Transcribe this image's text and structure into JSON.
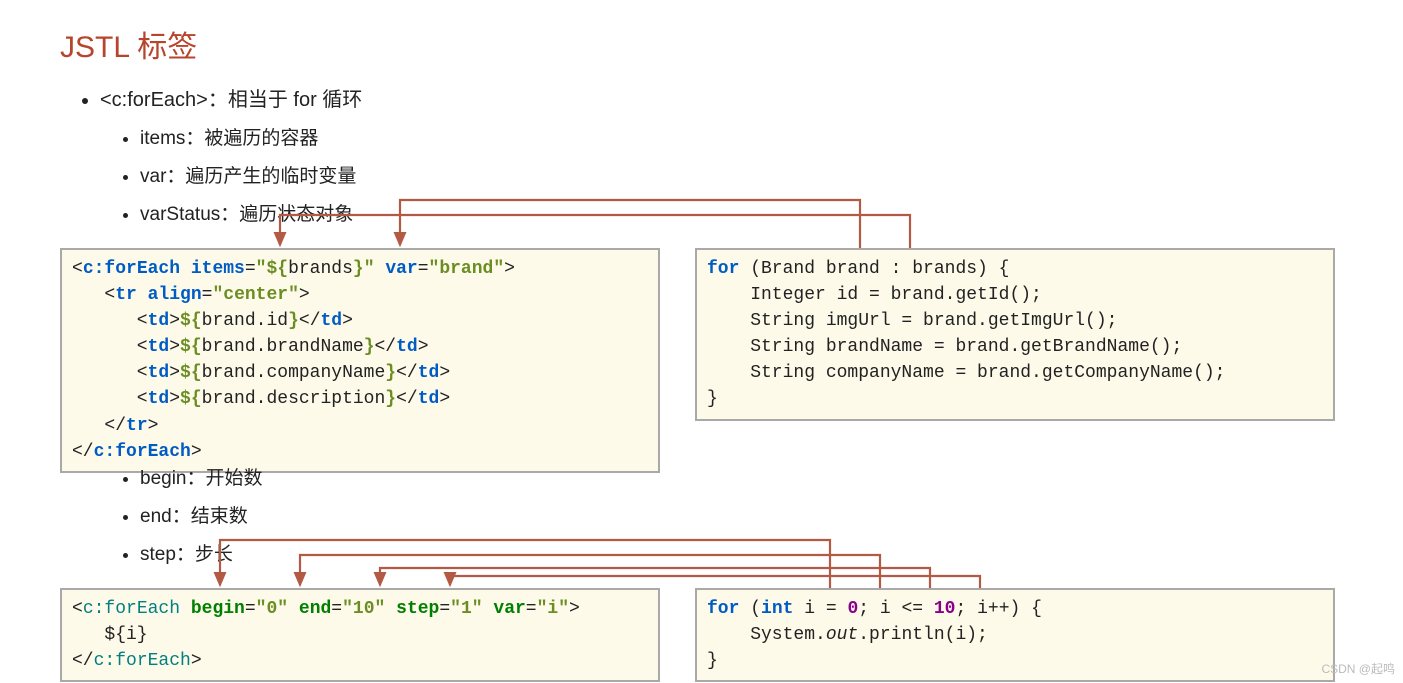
{
  "title": "JSTL 标签",
  "mainBullet": "<c:forEach>：相当于 for 循环",
  "subBullets1": {
    "items": "items：被遍历的容器",
    "var": "var：遍历产生的临时变量",
    "varStatus": "varStatus：遍历状态对象"
  },
  "subBullets2": {
    "begin": "begin：开始数",
    "end": "end：结束数",
    "step": "step：步长"
  },
  "code1_left": {
    "l1_a": "<",
    "l1_b": "c:forEach",
    "l1_c": " ",
    "l1_d": "items",
    "l1_e": "=",
    "l1_f": "\"${",
    "l1_g": "brands",
    "l1_h": "}\"",
    "l1_i": " ",
    "l1_j": "var",
    "l1_k": "=",
    "l1_l": "\"brand\"",
    "l1_m": ">",
    "l2_a": "   <",
    "l2_b": "tr",
    "l2_c": " ",
    "l2_d": "align",
    "l2_e": "=",
    "l2_f": "\"center\"",
    "l2_g": ">",
    "l3_a": "      <",
    "l3_b": "td",
    "l3_c": ">",
    "l3_d": "${",
    "l3_e": "brand.id",
    "l3_f": "}",
    "l3_g": "</",
    "l3_h": "td",
    "l3_i": ">",
    "l4_a": "      <",
    "l4_b": "td",
    "l4_c": ">",
    "l4_d": "${",
    "l4_e": "brand.brandName",
    "l4_f": "}",
    "l4_g": "</",
    "l4_h": "td",
    "l4_i": ">",
    "l5_a": "      <",
    "l5_b": "td",
    "l5_c": ">",
    "l5_d": "${",
    "l5_e": "brand.companyName",
    "l5_f": "}",
    "l5_g": "</",
    "l5_h": "td",
    "l5_i": ">",
    "l6_a": "      <",
    "l6_b": "td",
    "l6_c": ">",
    "l6_d": "${",
    "l6_e": "brand.description",
    "l6_f": "}",
    "l6_g": "</",
    "l6_h": "td",
    "l6_i": ">",
    "l7_a": "   </",
    "l7_b": "tr",
    "l7_c": ">",
    "l8_a": "</",
    "l8_b": "c:forEach",
    "l8_c": ">"
  },
  "code1_right": {
    "l1_a": "for",
    "l1_b": " (Brand brand : brands) {",
    "l2": "    Integer id = brand.getId();",
    "l3": "    String imgUrl = brand.getImgUrl();",
    "l4": "    String brandName = brand.getBrandName();",
    "l5": "    String companyName = brand.getCompanyName();",
    "l6": "}"
  },
  "code2_left": {
    "l1_a": "<",
    "l1_b": "c:forEach",
    "l1_c": " ",
    "l1_d": "begin",
    "l1_e": "=",
    "l1_f": "\"0\"",
    "l1_g": " ",
    "l1_h": "end",
    "l1_i": "=",
    "l1_j": "\"10\"",
    "l1_k": " ",
    "l1_l": "step",
    "l1_m": "=",
    "l1_n": "\"1\"",
    "l1_o": " ",
    "l1_p": "var",
    "l1_q": "=",
    "l1_r": "\"i\"",
    "l1_s": ">",
    "l2": "   ${i}",
    "l3_a": "</",
    "l3_b": "c:forEach",
    "l3_c": ">"
  },
  "code2_right": {
    "l1_a": "for",
    "l1_b": " (",
    "l1_c": "int",
    "l1_d": " i = ",
    "l1_e": "0",
    "l1_f": "; i <= ",
    "l1_g": "10",
    "l1_h": "; i++) {",
    "l2_a": "    System.",
    "l2_b": "out",
    "l2_c": ".println(i);",
    "l3": "}"
  },
  "watermark": "CSDN @起鸣"
}
